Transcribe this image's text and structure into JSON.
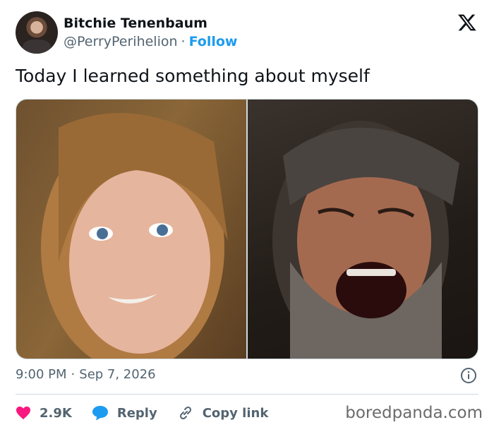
{
  "author": {
    "display_name": "Bitchie Tenenbaum",
    "handle": "@PerryPerihelion",
    "separator": "·",
    "follow_label": "Follow"
  },
  "tweet": {
    "text": "Today I learned something about myself",
    "time": "9:00 PM",
    "date": "Sep 7, 2026",
    "separator": "·"
  },
  "actions": {
    "like_count": "2.9K",
    "reply_label": "Reply",
    "copy_link_label": "Copy link"
  },
  "watermark": "boredpanda.com",
  "colors": {
    "accent": "#1d9bf0",
    "like": "#f91880",
    "text_primary": "#0f1419",
    "text_secondary": "#536471",
    "border": "#cfd9de"
  },
  "icons": {
    "brand": "x-logo-icon",
    "info": "info-icon",
    "like": "heart-icon",
    "reply": "speech-bubble-icon",
    "copy_link": "link-icon"
  }
}
